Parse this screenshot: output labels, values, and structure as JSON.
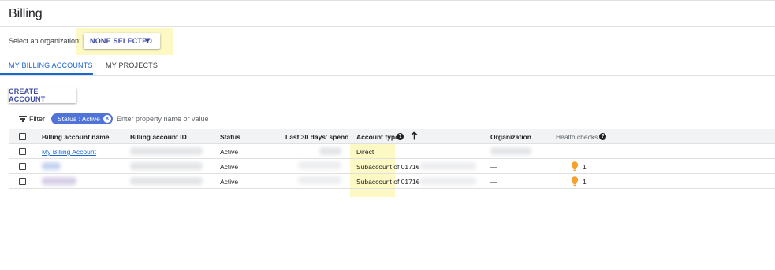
{
  "header": {
    "title": "Billing"
  },
  "org": {
    "label": "Select an organization:",
    "selected": "NONE SELECTED"
  },
  "tabs": [
    {
      "label": "MY BILLING ACCOUNTS",
      "active": true
    },
    {
      "label": "MY PROJECTS",
      "active": false
    }
  ],
  "actions": {
    "create_account": "CREATE ACCOUNT"
  },
  "filter": {
    "label": "Filter",
    "chip": "Status : Active",
    "placeholder": "Enter property name or value"
  },
  "table": {
    "columns": [
      "Billing account name",
      "Billing account ID",
      "Status",
      "Last 30 days' spend",
      "Account type",
      "Organization",
      "Health checks"
    ],
    "rows": [
      {
        "name": "My Billing Account",
        "status": "Active",
        "account_type": "Direct",
        "organization": "",
        "health": ""
      },
      {
        "name": "",
        "status": "Active",
        "account_type": "Subaccount of 0171€",
        "organization": "—",
        "health": "1"
      },
      {
        "name": "",
        "status": "Active",
        "account_type": "Subaccount of 0171€",
        "organization": "—",
        "health": "1"
      }
    ]
  },
  "colors": {
    "accent": "#1967d2",
    "chip": "#4f73d6",
    "highlight": "#fdf9c4",
    "warning": "#f6a12e"
  },
  "icons": [
    "dropdown-caret-icon",
    "filter-icon",
    "close-icon",
    "help-icon",
    "sort-ascending-icon",
    "lightbulb-icon"
  ]
}
